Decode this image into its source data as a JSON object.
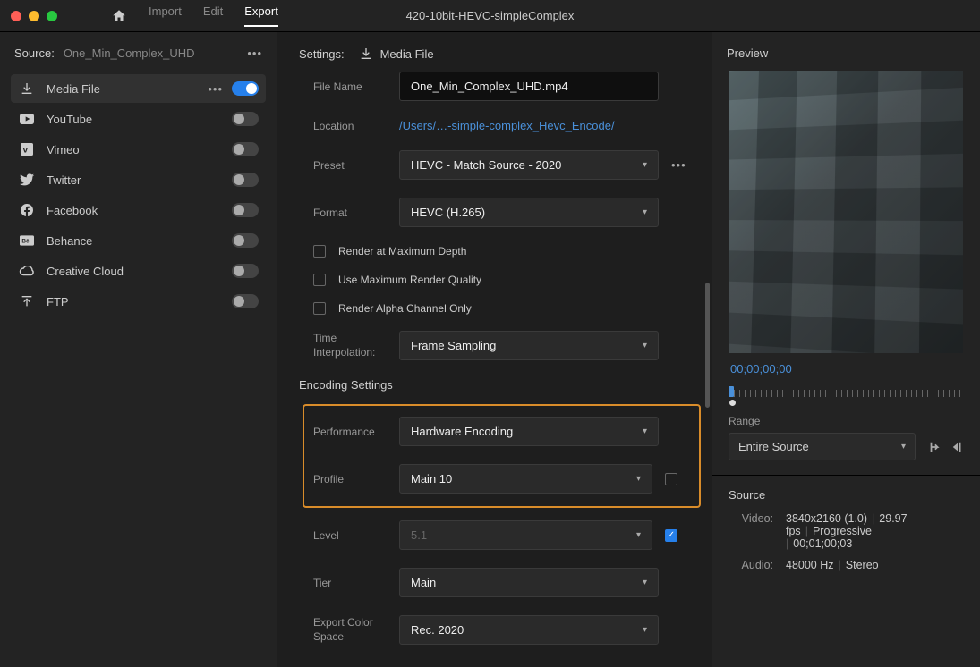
{
  "window": {
    "title": "420-10bit-HEVC-simpleComplex"
  },
  "topTabs": {
    "import": "Import",
    "edit": "Edit",
    "export": "Export"
  },
  "source": {
    "label": "Source:",
    "name": "One_Min_Complex_UHD"
  },
  "destinations": [
    {
      "key": "media-file",
      "label": "Media File",
      "on": true,
      "active": true
    },
    {
      "key": "youtube",
      "label": "YouTube",
      "on": false
    },
    {
      "key": "vimeo",
      "label": "Vimeo",
      "on": false
    },
    {
      "key": "twitter",
      "label": "Twitter",
      "on": false
    },
    {
      "key": "facebook",
      "label": "Facebook",
      "on": false
    },
    {
      "key": "behance",
      "label": "Behance",
      "on": false
    },
    {
      "key": "creative-cloud",
      "label": "Creative Cloud",
      "on": false
    },
    {
      "key": "ftp",
      "label": "FTP",
      "on": false
    }
  ],
  "settings": {
    "headerLabel": "Settings:",
    "headerChip": "Media File",
    "fileNameLabel": "File Name",
    "fileName": "One_Min_Complex_UHD.mp4",
    "locationLabel": "Location",
    "location": "/Users/…-simple-complex_Hevc_Encode/",
    "presetLabel": "Preset",
    "preset": "HEVC - Match Source - 2020",
    "formatLabel": "Format",
    "format": "HEVC (H.265)",
    "renderMaxDepth": "Render at Maximum Depth",
    "useMaxQuality": "Use Maximum Render Quality",
    "renderAlpha": "Render Alpha Channel Only",
    "timeInterpLabel": "Time Interpolation:",
    "timeInterp": "Frame Sampling",
    "encodingTitle": "Encoding Settings",
    "performanceLabel": "Performance",
    "performance": "Hardware Encoding",
    "profileLabel": "Profile",
    "profile": "Main 10",
    "levelLabel": "Level",
    "level": "5.1",
    "tierLabel": "Tier",
    "tier": "Main",
    "colorSpaceLabel": "Export Color Space",
    "colorSpace": "Rec. 2020"
  },
  "preview": {
    "header": "Preview",
    "timecode": "00;00;00;00",
    "rangeLabel": "Range",
    "range": "Entire Source",
    "sourceTitle": "Source",
    "videoLabel": "Video:",
    "videoRes": "3840x2160 (1.0)",
    "videoFps": "29.97 fps",
    "videoScan": "Progressive",
    "videoDur": "00;01;00;03",
    "audioLabel": "Audio:",
    "audioRate": "48000 Hz",
    "audioCh": "Stereo"
  }
}
